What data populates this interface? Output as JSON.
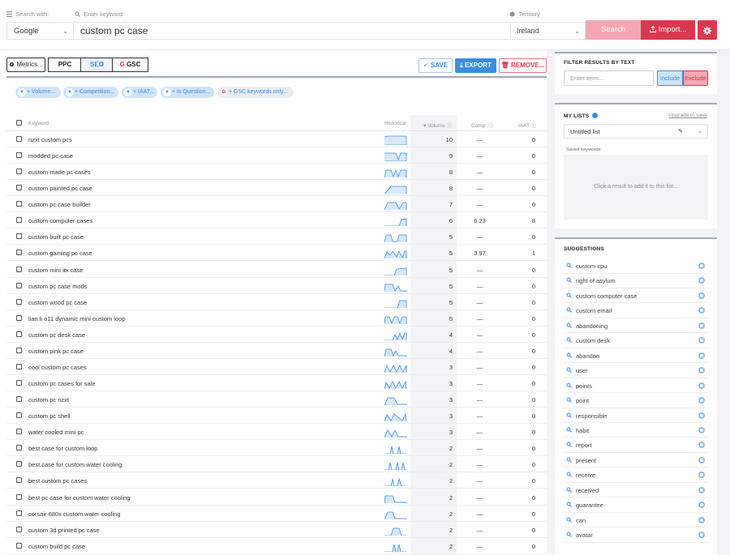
{
  "topbar": {
    "search_with_label": "Search with:",
    "keyword_label": "Enter keyword",
    "territory_label": "Territory",
    "engine": "Google",
    "keyword": "custom pc case",
    "territory": "Ireland",
    "search_label": "Search",
    "import_label": "Import..."
  },
  "toolbar": {
    "metrics_label": "Metrics...",
    "ppc_label": "PPC",
    "seo_label": "SEO",
    "gsc_label": "GSC",
    "save_label": "SAVE",
    "export_label": "EXPORT",
    "remove_label": "REMOVE..."
  },
  "filters": [
    {
      "label": "+ Volume..."
    },
    {
      "label": "+ Competition..."
    },
    {
      "label": "+ IAAT..."
    },
    {
      "label": "+ Is Question..."
    },
    {
      "label": "+ GSC keywords only..."
    }
  ],
  "table": {
    "col_keyword": "Keyword",
    "col_historical": "Historical",
    "col_volume": "Volume",
    "col_comp": "Comp.",
    "col_iaat": "IAAT",
    "rows": [
      {
        "kw": "nzxt custom pcs",
        "vol": "10",
        "comp": "—",
        "iaat": "0",
        "h": "flat"
      },
      {
        "kw": "modded pc case",
        "vol": "9",
        "comp": "—",
        "iaat": "0",
        "h": "dip"
      },
      {
        "kw": "custom made pc cases",
        "vol": "8",
        "comp": "—",
        "iaat": "0",
        "h": "w"
      },
      {
        "kw": "custom painted pc case",
        "vol": "8",
        "comp": "—",
        "iaat": "0",
        "h": "rise"
      },
      {
        "kw": "custom pc case builder",
        "vol": "7",
        "comp": "—",
        "iaat": "0",
        "h": "hump"
      },
      {
        "kw": "custom computer cases",
        "vol": "6",
        "comp": "6.23",
        "iaat": "8",
        "h": "late"
      },
      {
        "kw": "custom built pc case",
        "vol": "5",
        "comp": "—",
        "iaat": "0",
        "h": "step"
      },
      {
        "kw": "custom gaming pc case",
        "vol": "5",
        "comp": "3.97",
        "iaat": "1",
        "h": "m"
      },
      {
        "kw": "custom mini itx case",
        "vol": "5",
        "comp": "—",
        "iaat": "0",
        "h": "late2"
      },
      {
        "kw": "custom pc case mods",
        "vol": "5",
        "comp": "—",
        "iaat": "0",
        "h": "wdown"
      },
      {
        "kw": "custom wood pc case",
        "vol": "5",
        "comp": "—",
        "iaat": "0",
        "h": "late3"
      },
      {
        "kw": "lian li o11 dynamic mini custom loop",
        "vol": "5",
        "comp": "—",
        "iaat": "0",
        "h": "mm"
      },
      {
        "kw": "custom pc desk case",
        "vol": "4",
        "comp": "—",
        "iaat": "0",
        "h": "endw"
      },
      {
        "kw": "custom pink pc case",
        "vol": "4",
        "comp": "—",
        "iaat": "0",
        "h": "early"
      },
      {
        "kw": "cool custom pc cases",
        "vol": "3",
        "comp": "—",
        "iaat": "0",
        "h": "m2"
      },
      {
        "kw": "custom pc cases for sale",
        "vol": "3",
        "comp": "—",
        "iaat": "0",
        "h": "m3"
      },
      {
        "kw": "custom pc nzxt",
        "vol": "3",
        "comp": "—",
        "iaat": "0",
        "h": "hump2"
      },
      {
        "kw": "custom pc shell",
        "vol": "3",
        "comp": "—",
        "iaat": "0",
        "h": "m4"
      },
      {
        "kw": "water cooled mini pc",
        "vol": "3",
        "comp": "—",
        "iaat": "0",
        "h": "hump3"
      },
      {
        "kw": "best case for custom loop",
        "vol": "2",
        "comp": "—",
        "iaat": "0",
        "h": "spikes"
      },
      {
        "kw": "best case for custom water cooling",
        "vol": "2",
        "comp": "—",
        "iaat": "0",
        "h": "spikes2"
      },
      {
        "kw": "best custom pc cases",
        "vol": "2",
        "comp": "—",
        "iaat": "0",
        "h": "spikes3"
      },
      {
        "kw": "best pc case for custom water cooling",
        "vol": "2",
        "comp": "—",
        "iaat": "0",
        "h": "early2"
      },
      {
        "kw": "corsair 680x custom water cooling",
        "vol": "2",
        "comp": "—",
        "iaat": "0",
        "h": "early3"
      },
      {
        "kw": "custom 3d printed pc case",
        "vol": "2",
        "comp": "—",
        "iaat": "0",
        "h": "mid"
      },
      {
        "kw": "custom build pc case",
        "vol": "2",
        "comp": "—",
        "iaat": "0",
        "h": "spikes4"
      }
    ]
  },
  "filter_panel": {
    "title": "FILTER RESULTS BY TEXT",
    "placeholder": "Enter term...",
    "include_label": "Include",
    "exclude_label": "Exclude"
  },
  "lists_panel": {
    "title": "MY LISTS",
    "upgrade_label": "Upgrade to save",
    "list_name": "Untitled list",
    "saved_label": "Saved keywords",
    "empty_msg": "Click a result to add it to this list..."
  },
  "suggestions": {
    "title": "SUGGESTIONS",
    "items": [
      "custom cpu",
      "right of asylum",
      "custom computer case",
      "custom email",
      "abandoning",
      "custom desk",
      "abandon",
      "user",
      "points",
      "point",
      "responsible",
      "habit",
      "report",
      "present",
      "receive",
      "received",
      "guarantee",
      "can",
      "avatar"
    ]
  },
  "colors": {
    "accent": "#3a8de0",
    "brand_red": "#d9394f",
    "pink": "#f5a6b2"
  }
}
